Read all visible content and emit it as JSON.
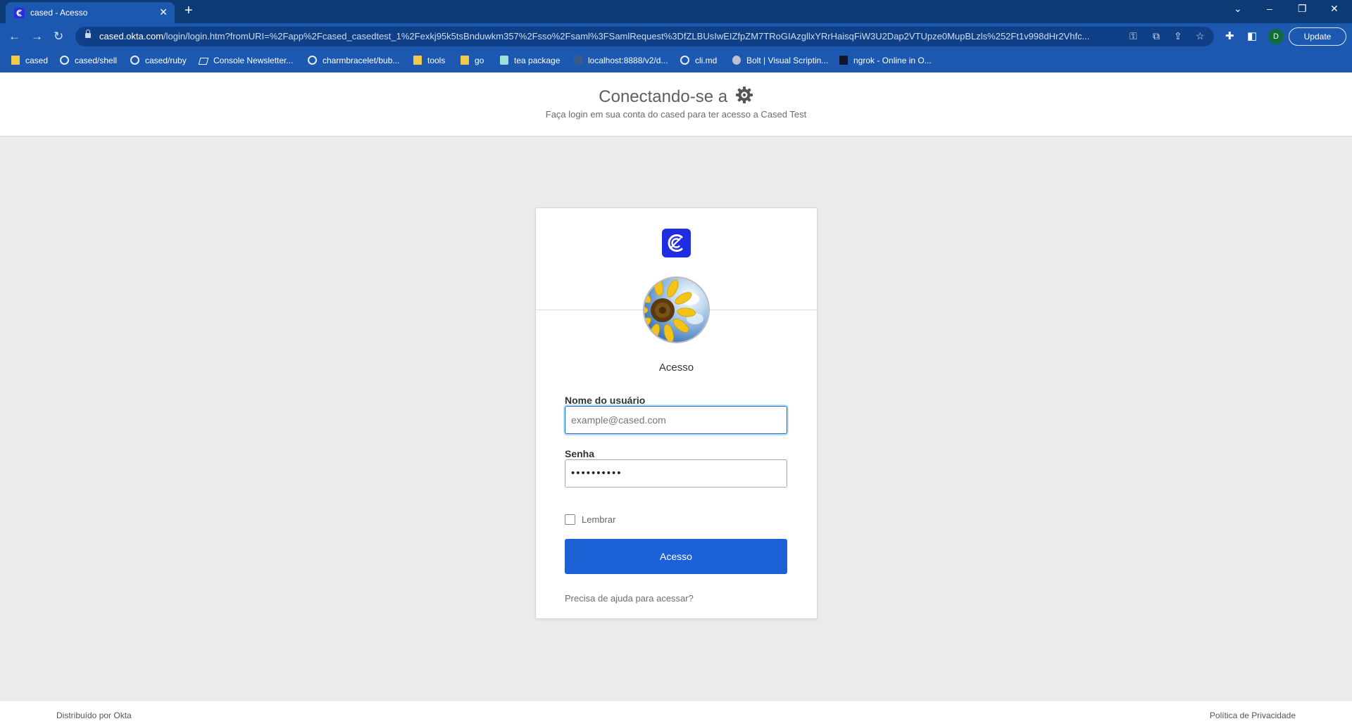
{
  "browser": {
    "tab_title": "cased - Acesso",
    "url_domain": "cased.okta.com",
    "url_path": "/login/login.htm?fromURI=%2Fapp%2Fcased_casedtest_1%2Fexkj95k5tsBnduwkm357%2Fsso%2Fsaml%3FSamlRequest%3DfZLBUsIwEIZfpZM7TRoGIAzgllxYRrHaisqFiW3U2Dap2VTUpze0MupBLzls%252Ft1v998dHr2Vhfc...",
    "update_label": "Update",
    "profile_initial": "D",
    "bookmarks": [
      {
        "label": "cased",
        "icon": "folder"
      },
      {
        "label": "cased/shell",
        "icon": "github"
      },
      {
        "label": "cased/ruby",
        "icon": "github"
      },
      {
        "label": "Console Newsletter...",
        "icon": "console"
      },
      {
        "label": "charmbracelet/bub...",
        "icon": "github"
      },
      {
        "label": "tools",
        "icon": "folder"
      },
      {
        "label": "go",
        "icon": "folder"
      },
      {
        "label": "tea package",
        "icon": "tea"
      },
      {
        "label": "localhost:8888/v2/d...",
        "icon": "local"
      },
      {
        "label": "cli.md",
        "icon": "github"
      },
      {
        "label": "Bolt | Visual Scriptin...",
        "icon": "bolt"
      },
      {
        "label": "ngrok - Online in O...",
        "icon": "ngrok"
      }
    ]
  },
  "header": {
    "title": "Conectando-se a",
    "subtitle": "Faça login em sua conta do cased para ter acesso a Cased Test"
  },
  "form": {
    "heading": "Acesso",
    "username_label": "Nome do usuário",
    "username_placeholder": "example@cased.com",
    "password_label": "Senha",
    "password_value": "••••••••••",
    "remember_label": "Lembrar",
    "submit_label": "Acesso",
    "help_link": "Precisa de ajuda para acessar?"
  },
  "footer": {
    "powered_by": "Distribuído por Okta",
    "privacy": "Política de Privacidade"
  },
  "colors": {
    "chrome_dark": "#0b3a75",
    "chrome": "#1c58b0",
    "brand_logo": "#1f2ce0",
    "primary_button": "#1a62d6",
    "focus_ring": "#bfe6f7"
  }
}
